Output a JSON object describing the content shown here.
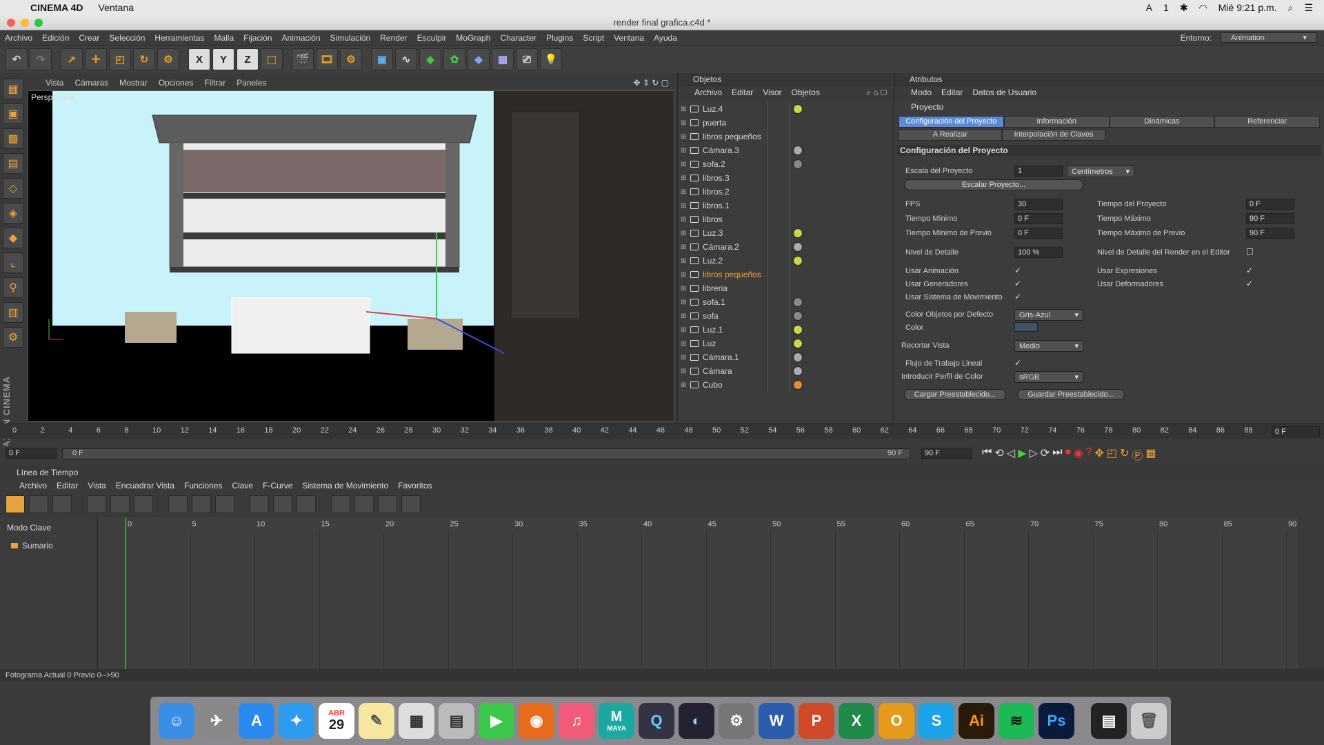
{
  "mac_menubar": {
    "app_name": "CINEMA 4D",
    "menu": "Ventana",
    "battery_label": "1",
    "clock": "Mié 9:21 p.m."
  },
  "window": {
    "title": "render final grafica.c4d *"
  },
  "app_menu": {
    "items": [
      "Archivo",
      "Edición",
      "Crear",
      "Selección",
      "Herramientas",
      "Malla",
      "Fijación",
      "Animación",
      "Simulación",
      "Render",
      "Esculpir",
      "MoGraph",
      "Character",
      "Plugins",
      "Script",
      "Ventana",
      "Ayuda"
    ],
    "environment_label": "Entorno:",
    "environment_value": "Animation"
  },
  "toolbar": {
    "axis_x": "X",
    "axis_y": "Y",
    "axis_z": "Z"
  },
  "viewport": {
    "menu": [
      "Vista",
      "Cámaras",
      "Mostrar",
      "Opciones",
      "Filtrar",
      "Paneles"
    ],
    "label": "Perspectiva"
  },
  "objects_panel": {
    "title": "Objetos",
    "menu": [
      "Archivo",
      "Editar",
      "Visor",
      "Objetos"
    ],
    "rows": [
      {
        "name": "Luz.4",
        "type": "light"
      },
      {
        "name": "puerta",
        "type": "null"
      },
      {
        "name": "libros pequeños",
        "type": "null"
      },
      {
        "name": "Cámara.3",
        "type": "camera"
      },
      {
        "name": "sofa.2",
        "type": "null"
      },
      {
        "name": "libros.3",
        "type": "null"
      },
      {
        "name": "libros.2",
        "type": "null"
      },
      {
        "name": "libros.1",
        "type": "null"
      },
      {
        "name": "libros",
        "type": "null"
      },
      {
        "name": "Luz.3",
        "type": "light"
      },
      {
        "name": "Cámara.2",
        "type": "camera"
      },
      {
        "name": "Luz.2",
        "type": "light"
      },
      {
        "name": "libros pequeños",
        "type": "null",
        "highlight": true
      },
      {
        "name": "libreria",
        "type": "null"
      },
      {
        "name": "sofa.1",
        "type": "null"
      },
      {
        "name": "sofa",
        "type": "null"
      },
      {
        "name": "Luz.1",
        "type": "light"
      },
      {
        "name": "Luz",
        "type": "light"
      },
      {
        "name": "Cámara.1",
        "type": "camera"
      },
      {
        "name": "Cámara",
        "type": "camera"
      },
      {
        "name": "Cubo",
        "type": "cube"
      }
    ]
  },
  "attributes_panel": {
    "title": "Atributos",
    "menu": [
      "Modo",
      "Editar",
      "Datos de Usuario"
    ],
    "section": "Proyecto",
    "tabs_row1": [
      "Configuración del Proyecto",
      "Información",
      "Dinámicas",
      "Referenciar"
    ],
    "tabs_row2": [
      "A Realizar",
      "Interpolación de Claves"
    ],
    "heading": "Configuración del Proyecto",
    "escala_label": "Escala del Proyecto",
    "escala_value": "1",
    "escala_unit": "Centímetros",
    "escalar_button": "Escalar Proyecto...",
    "fps_label": "FPS",
    "fps_value": "30",
    "tiempo_proyecto_label": "Tiempo del Proyecto",
    "tiempo_proyecto_value": "0 F",
    "tiempo_min_label": "Tiempo Mínimo",
    "tiempo_min_value": "0 F",
    "tiempo_max_label": "Tiempo Máximo",
    "tiempo_max_value": "90 F",
    "tiempo_min_prev_label": "Tiempo Mínimo de Previo",
    "tiempo_min_prev_value": "0 F",
    "tiempo_max_prev_label": "Tiempo Máximo de Previo",
    "tiempo_max_prev_value": "90 F",
    "nivel_label": "Nivel de Detalle",
    "nivel_value": "100 %",
    "nivel_render_label": "Nivel de Detalle del Render en el Editor",
    "usar_animacion": "Usar Animación",
    "usar_expresiones": "Usar Expresiones",
    "usar_generadores": "Usar Generadores",
    "usar_deformadores": "Usar Deformadores",
    "usar_movimiento": "Usar Sistema de Movimiento",
    "color_obj_label": "Color Objetos por Defecto",
    "color_obj_value": "Gris-Azul",
    "color_label": "Color",
    "recortar_label": "Recortar Vista",
    "recortar_value": "Medio",
    "flujo_label": "Flujo de Trabajo Lineal",
    "perfil_label": "Introducir Perfil de Color",
    "perfil_value": "sRGB",
    "cargar_button": "Cargar Preestablecido...",
    "guardar_button": "Guardar Preestablecido..."
  },
  "timeline_ruler": {
    "ticks": [
      "0",
      "2",
      "4",
      "6",
      "8",
      "10",
      "12",
      "14",
      "16",
      "18",
      "20",
      "22",
      "24",
      "26",
      "28",
      "30",
      "32",
      "34",
      "36",
      "38",
      "40",
      "42",
      "44",
      "46",
      "48",
      "50",
      "52",
      "54",
      "56",
      "58",
      "60",
      "62",
      "64",
      "66",
      "68",
      "70",
      "72",
      "74",
      "76",
      "78",
      "80",
      "82",
      "84",
      "86",
      "88",
      "90"
    ],
    "frame_field": "0 F"
  },
  "transport": {
    "current": "0 F",
    "start": "0 F",
    "end": "90 F",
    "end2": "90 F"
  },
  "timeline": {
    "title": "Línea de Tiempo",
    "menu": [
      "Archivo",
      "Editar",
      "Vista",
      "Encuadrar Vista",
      "Funciones",
      "Clave",
      "F-Curve",
      "Sistema de Movimiento",
      "Favoritos"
    ],
    "mode": "Modo Clave",
    "summary": "Sumario",
    "ruler": [
      "0",
      "5",
      "10",
      "15",
      "20",
      "25",
      "30",
      "35",
      "40",
      "45",
      "50",
      "55",
      "60",
      "65",
      "70",
      "75",
      "80",
      "85",
      "90"
    ]
  },
  "status": {
    "text": "Fotograma Actual  0  Previo  0-->90"
  },
  "dock": {
    "calendar_month": "ABR",
    "calendar_day": "29",
    "maya_label": "MAYA"
  }
}
